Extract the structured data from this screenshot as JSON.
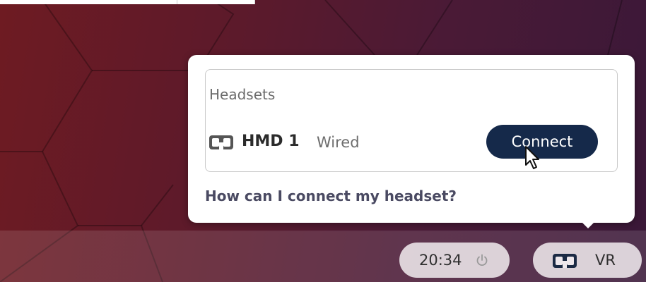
{
  "popup": {
    "section_title": "Headsets",
    "headset": {
      "icon": "vr-headset-icon",
      "name": "HMD 1",
      "connection": "Wired",
      "action_label": "Connect"
    },
    "help_link": "How can I connect my headset?"
  },
  "panel": {
    "clock": {
      "time": "20:34",
      "icon": "power-icon"
    },
    "vr_indicator": {
      "icon": "vr-headset-icon",
      "label": "VR"
    }
  },
  "colors": {
    "connect_button": "#15294a",
    "help_link": "#4a4a62",
    "wallpaper_left": "#6e1b22",
    "wallpaper_right": "#3a1838"
  }
}
